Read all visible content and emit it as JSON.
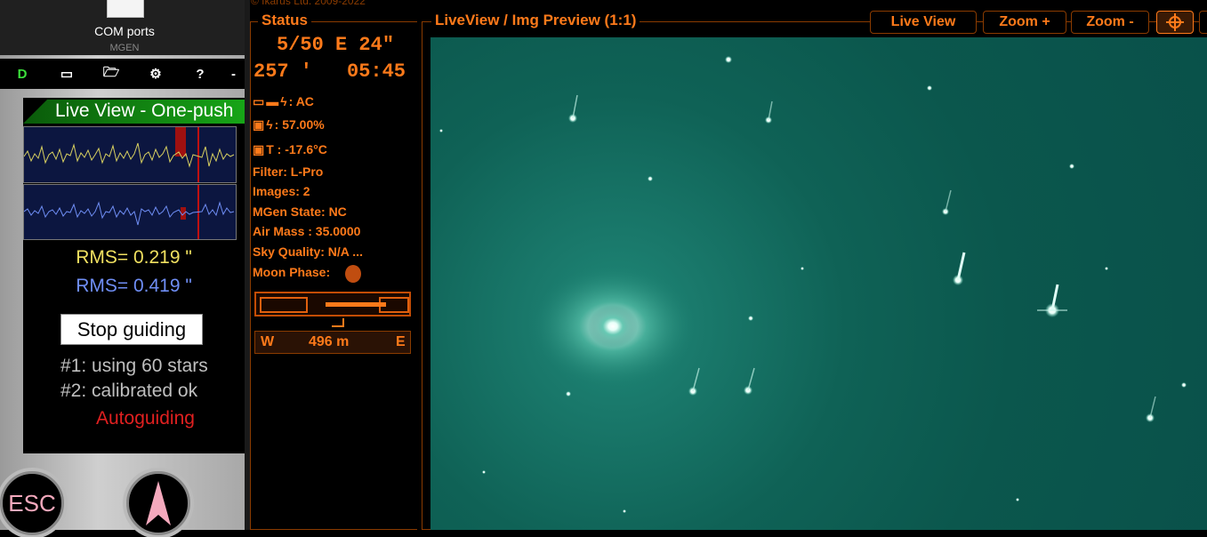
{
  "desktop": {
    "icon_label": "COM ports",
    "icon_sublabel": "MGEN"
  },
  "mgen": {
    "toolbar": {
      "d_label": "D",
      "help_label": "?"
    },
    "banner": "Live View - One-push",
    "rms_ra": "RMS= 0.219 \"",
    "rms_dec": "RMS= 0.419 \"",
    "stop_button": "Stop guiding",
    "info_line1": "#1: using 60 stars",
    "info_line2": "#2: calibrated ok",
    "state": "Autoguiding",
    "esc_button": "ESC",
    "colors": {
      "ra": "#f0e060",
      "dec": "#6f8ef5",
      "state": "#e02020"
    }
  },
  "status": {
    "copyright": "© Ikarus Ltd. 2009-2022",
    "title": "Status",
    "pos_line1": "5/50 E  24\"",
    "pos_az": "257 '",
    "time": "05:45",
    "power": ": AC",
    "battery": ": 57.00%",
    "temp": "T : -17.6°C",
    "filter": "Filter: L-Pro",
    "images": "Images: 2",
    "mgen_state": "MGen State: NC",
    "air_mass": "Air Mass : 35.0000",
    "sky_quality": "Sky Quality: N/A ...",
    "moon_phase": "Moon Phase:",
    "west": "W",
    "meridian": "496 m",
    "east": "E",
    "accent": "#ff7a1a"
  },
  "liveview": {
    "title": "LiveView / Img Preview (1:1)",
    "btn_liveview": "Live View",
    "btn_zoom_in": "Zoom +",
    "btn_zoom_out": "Zoom -",
    "background": "#0b574d"
  }
}
